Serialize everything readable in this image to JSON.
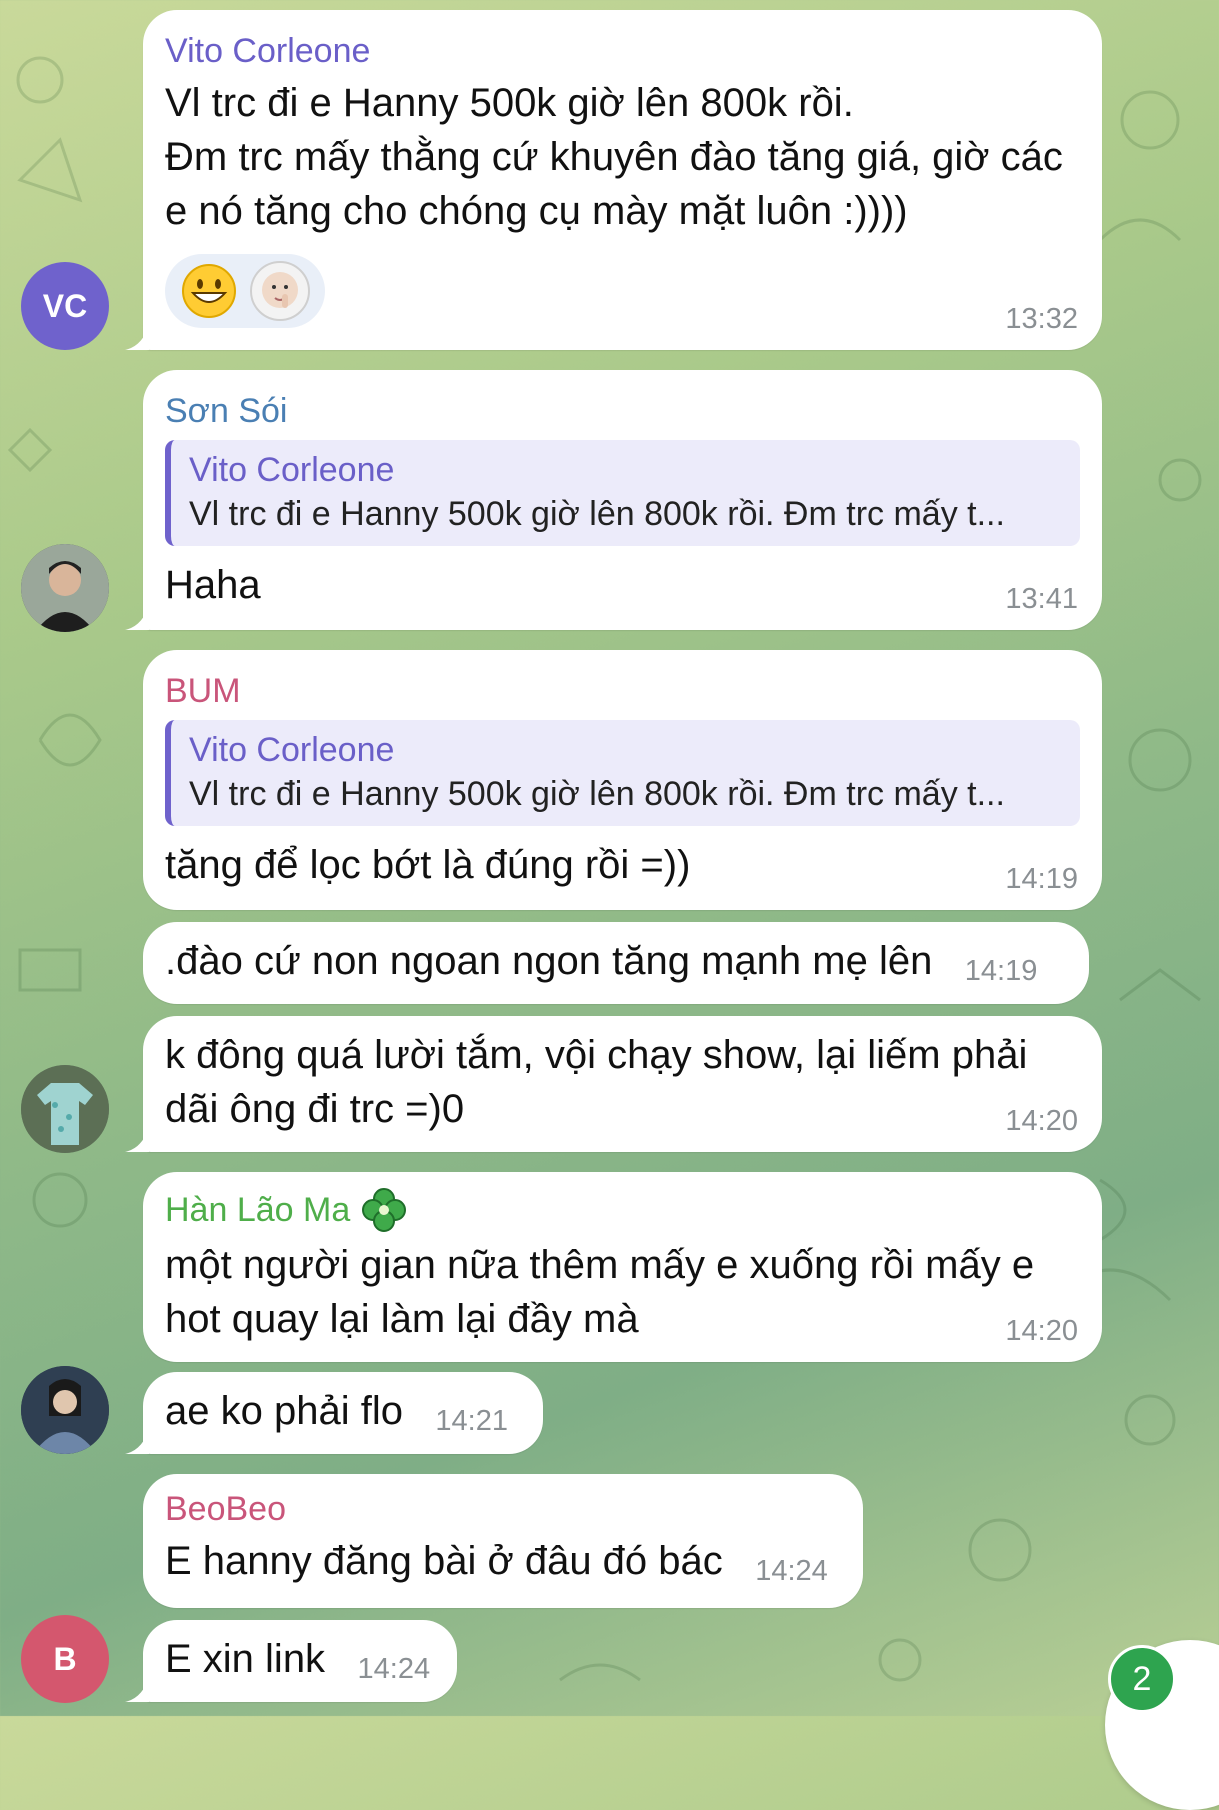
{
  "colors": {
    "vito": "#6a5fc8",
    "son": "#4a7fb3",
    "bum": "#c9557a",
    "han": "#4fae4a",
    "beobeo": "#c9557a",
    "avatar_vc": "#6f62cc",
    "avatar_b": "#d4576e",
    "unread_badge": "#2ea44f"
  },
  "messages": {
    "m1": {
      "sender": "Vito Corleone",
      "text": "Vl trc đi e Hanny 500k giờ lên 800k rồi.\nĐm trc mấy thằng cứ khuyên đào tăng giá, giờ các e nó tăng cho chóng cụ mày mặt luôn :))))",
      "time": "13:32",
      "reactions": [
        "grinning-emoji",
        "baby-sticker-reaction"
      ]
    },
    "m2": {
      "sender": "Sơn Sói",
      "reply_name": "Vito Corleone",
      "reply_text": "Vl trc đi e Hanny 500k giờ lên 800k rồi. Đm trc mấy t...",
      "text": "Haha",
      "time": "13:41"
    },
    "m3": {
      "sender": "BUM",
      "reply_name": "Vito Corleone",
      "reply_text": "Vl trc đi e Hanny 500k giờ lên 800k rồi. Đm trc mấy t...",
      "text": "tăng để lọc bớt là đúng rồi =))",
      "time": "14:19"
    },
    "m4": {
      "text": ".đào cứ non ngoan ngon tăng mạnh mẹ lên",
      "time": "14:19"
    },
    "m5": {
      "text": "k đông quá lười tắm, vội chạy show, lại liếm phải dãi ông đi trc =)0",
      "time": "14:20"
    },
    "m6": {
      "sender": "Hàn Lão Ma",
      "text": "một người gian nữa thêm mấy e xuống rồi mấy e hot quay lại làm lại đầy mà",
      "time": "14:20"
    },
    "m7": {
      "text": "ae ko phải flo",
      "time": "14:21"
    },
    "m8": {
      "sender": "BeoBeo",
      "text": "E hanny đăng bài ở đâu đó bác",
      "time": "14:24"
    },
    "m9": {
      "text": "E xin link",
      "time": "14:24"
    }
  },
  "avatars": {
    "vc": "VC",
    "b": "B"
  },
  "unread_count": "2"
}
